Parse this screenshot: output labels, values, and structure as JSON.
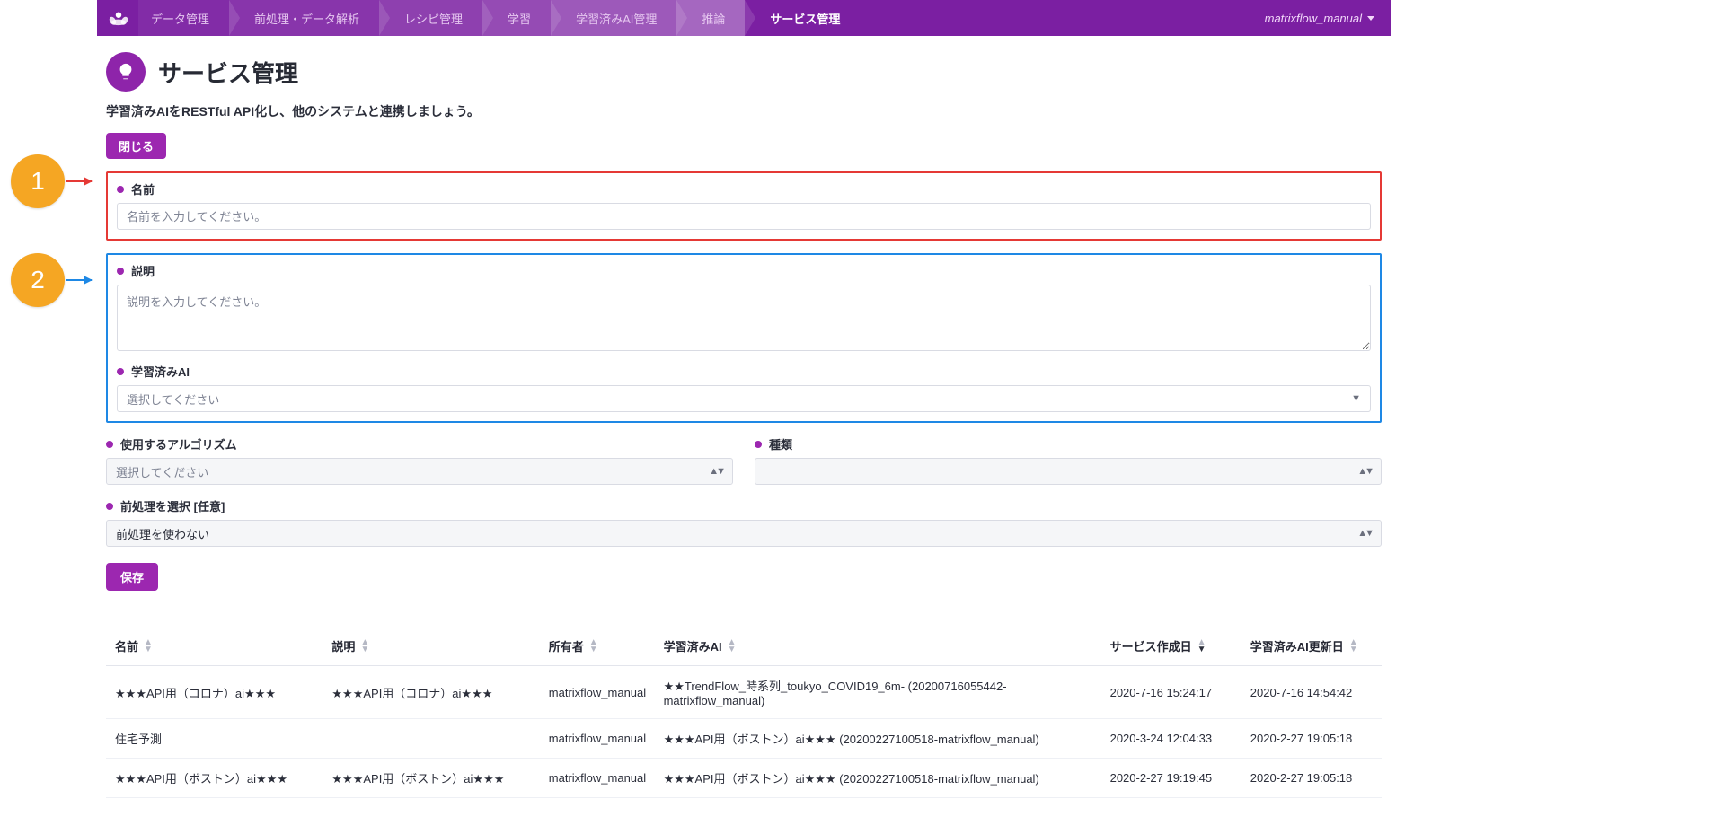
{
  "nav": {
    "items": [
      "データ管理",
      "前処理・データ解析",
      "レシピ管理",
      "学習",
      "学習済みAI管理",
      "推論",
      "サービス管理"
    ],
    "active_index": 6,
    "account": "matrixflow_manual"
  },
  "header": {
    "title": "サービス管理",
    "subtitle": "学習済みAIをRESTful API化し、他のシステムと連携しましょう。"
  },
  "buttons": {
    "close": "閉じる",
    "save": "保存"
  },
  "form": {
    "name": {
      "label": "名前",
      "placeholder": "名前を入力してください。"
    },
    "description": {
      "label": "説明",
      "placeholder": "説明を入力してください。"
    },
    "trained_ai": {
      "label": "学習済みAI",
      "placeholder": "選択してください"
    },
    "algorithm": {
      "label": "使用するアルゴリズム",
      "placeholder": "選択してください"
    },
    "kind": {
      "label": "種類",
      "placeholder": ""
    },
    "preprocess": {
      "label": "前処理を選択 [任意]",
      "value": "前処理を使わない"
    }
  },
  "callouts": {
    "one": "1",
    "two": "2"
  },
  "table": {
    "headers": {
      "name": "名前",
      "description": "説明",
      "owner": "所有者",
      "trained_ai": "学習済みAI",
      "service_created": "サービス作成日",
      "ai_updated": "学習済みAI更新日"
    },
    "rows": [
      {
        "name": "★★★API用（コロナ）ai★★★",
        "description": "★★★API用（コロナ）ai★★★",
        "owner": "matrixflow_manual",
        "trained_ai": "★★TrendFlow_時系列_toukyo_COVID19_6m- (20200716055442-matrixflow_manual)",
        "service_created": "2020-7-16 15:24:17",
        "ai_updated": "2020-7-16 14:54:42"
      },
      {
        "name": "住宅予測",
        "description": "",
        "owner": "matrixflow_manual",
        "trained_ai": "★★★API用（ボストン）ai★★★ (20200227100518-matrixflow_manual)",
        "service_created": "2020-3-24 12:04:33",
        "ai_updated": "2020-2-27 19:05:18"
      },
      {
        "name": "★★★API用（ボストン）ai★★★",
        "description": "★★★API用（ボストン）ai★★★",
        "owner": "matrixflow_manual",
        "trained_ai": "★★★API用（ボストン）ai★★★ (20200227100518-matrixflow_manual)",
        "service_created": "2020-2-27 19:19:45",
        "ai_updated": "2020-2-27 19:05:18"
      }
    ]
  }
}
